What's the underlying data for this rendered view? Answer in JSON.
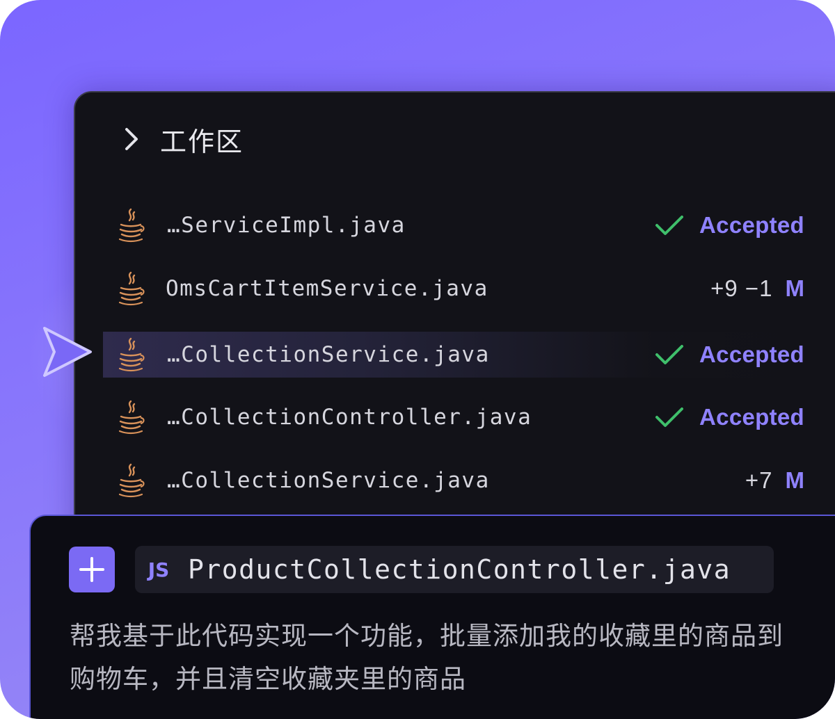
{
  "colors": {
    "background_gradient": [
      "#7b66ff",
      "#9d90f2"
    ],
    "panel": "#121218",
    "accent": "#8f82ff",
    "check_green": "#3fbf6b",
    "java_icon": "#d9925a"
  },
  "workspace": {
    "chevron_icon": "chevron-right-icon",
    "title": "工作区"
  },
  "files": [
    {
      "name": "…ServiceImpl.java",
      "icon": "java-icon",
      "status": "Accepted",
      "status_icon": "check-icon"
    },
    {
      "name": "OmsCartItemService.java",
      "icon": "java-icon",
      "diff": "+9 −1",
      "flag": "M"
    },
    {
      "name": "…CollectionService.java",
      "icon": "java-icon",
      "status": "Accepted",
      "status_icon": "check-icon",
      "active": true
    },
    {
      "name": "…CollectionController.java",
      "icon": "java-icon",
      "status": "Accepted",
      "status_icon": "check-icon"
    },
    {
      "name": "…CollectionService.java",
      "icon": "java-icon",
      "diff": "+7",
      "flag": "M"
    }
  ],
  "composer": {
    "add_icon": "plus-icon",
    "context_badge": "JS",
    "context_file": "ProductCollectionController.java",
    "prompt": "帮我基于此代码实现一个功能，批量添加我的收藏里的商品到购物车，并且清空收藏夹里的商品"
  }
}
